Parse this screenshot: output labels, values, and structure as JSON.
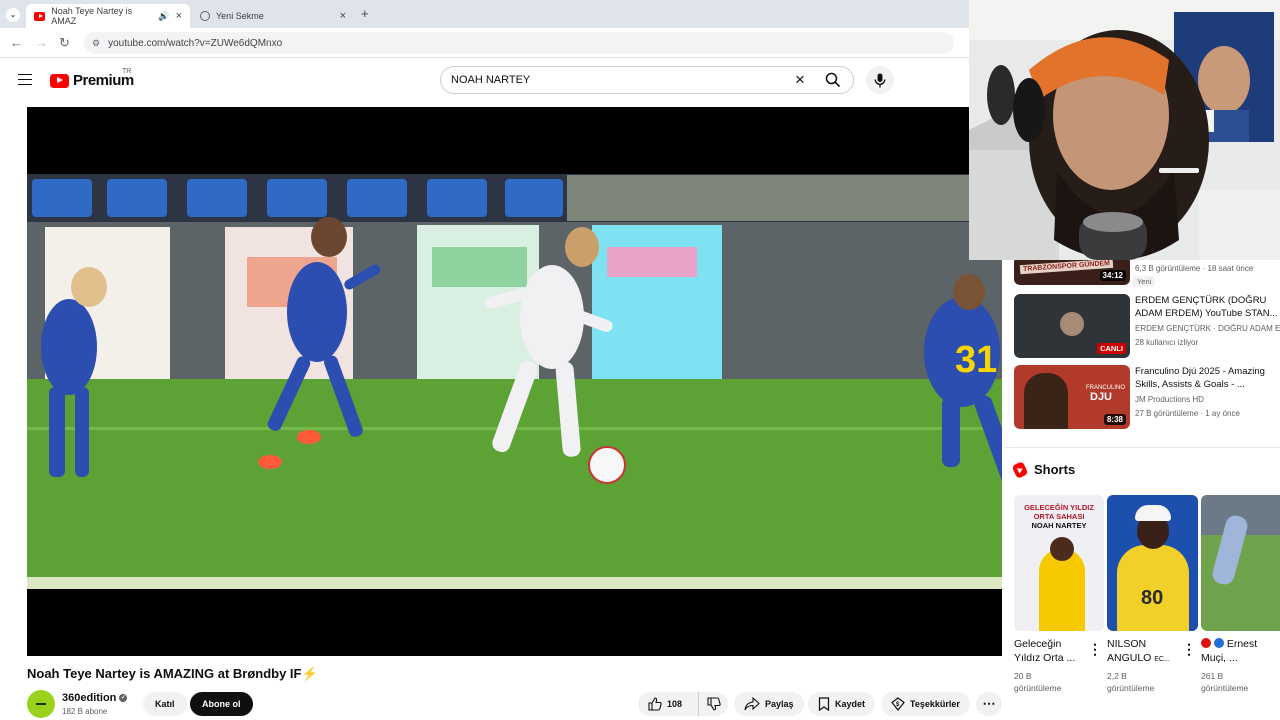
{
  "browser": {
    "tabs": [
      {
        "label": "Noah Teye Nartey is AMAZ",
        "icon": "youtube-favicon",
        "active": true
      },
      {
        "label": "Yeni Sekme",
        "icon": "globe-icon",
        "active": false
      }
    ],
    "url": "youtube.com/watch?v=ZUWe6dQMnxo"
  },
  "header": {
    "logo": "Premium",
    "country": "TR",
    "search_value": "NOAH NARTEY"
  },
  "video": {
    "title": "Noah Teye Nartey is AMAZING at Brøndby IF⚡",
    "channel": "360edition",
    "subscribers": "182 B abone",
    "join_label": "Katıl",
    "subscribe_label": "Abone ol",
    "likes": "108",
    "share_label": "Paylaş",
    "save_label": "Kaydet",
    "thanks_label": "Teşekkürler",
    "player_jersey_text": "31"
  },
  "sidebar": {
    "related": [
      {
        "title": "",
        "meta1": "6,3 B görüntüleme · 18 saat önce",
        "badge": "Yeni",
        "duration": "34:12",
        "thumb_text": "TRABZONSPOR GÜNDEM"
      },
      {
        "title": "ERDEM GENÇTÜRK (DOĞRU ADAM ERDEM) YouTube STAN...",
        "meta1": "ERDEM GENÇTÜRK · DOĞRU ADAM ERDEM",
        "meta2": "28 kullanıcı izliyor",
        "live": "CANLI"
      },
      {
        "title": "Franculino Djú 2025 - Amazing Skills, Assists & Goals - ...",
        "meta1": "JM Productions HD",
        "meta2": "27 B görüntüleme · 1 ay önce",
        "duration": "8:38",
        "thumb_text": "DJU",
        "thumb_small": "FRANCULINO"
      }
    ],
    "shorts_heading": "Shorts",
    "shorts": [
      {
        "title1": "Geleceğin",
        "title2": "Yıldız Orta ...",
        "views1": "20 B",
        "views2": "görüntüleme",
        "thumb_text1": "GELECEĞİN YILDIZ",
        "thumb_text2": "ORTA SAHASI",
        "thumb_text3": "NOAH NARTEY"
      },
      {
        "title1": "NILSON",
        "title2": "ANGULO",
        "title2_suffix": "EC...",
        "views1": "2,2 B",
        "views2": "görüntüleme",
        "thumb_text1": "80"
      },
      {
        "title1": "Ernest",
        "title2": "Muçi, ...",
        "views1": "261 B",
        "views2": "görüntüleme"
      }
    ]
  },
  "colors": {
    "brand": "#ff0000",
    "live": "#cc0000",
    "pitch": "#4e9a2a"
  }
}
